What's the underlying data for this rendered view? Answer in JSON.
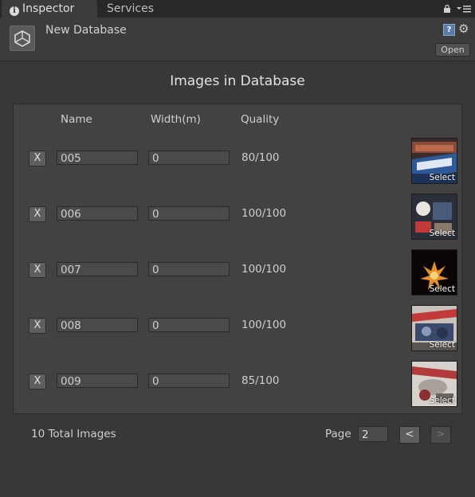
{
  "tabs": {
    "inspector": "Inspector",
    "services": "Services"
  },
  "header": {
    "title": "New Database",
    "open_label": "Open",
    "help_glyph": "?"
  },
  "section_title": "Images in Database",
  "columns": {
    "name": "Name",
    "width": "Width(m)",
    "quality": "Quality"
  },
  "rows": [
    {
      "remove": "X",
      "name": "005",
      "width": "0",
      "quality": "80/100",
      "thumb_label": "Select"
    },
    {
      "remove": "X",
      "name": "006",
      "width": "0",
      "quality": "100/100",
      "thumb_label": "Select"
    },
    {
      "remove": "X",
      "name": "007",
      "width": "0",
      "quality": "100/100",
      "thumb_label": "Select"
    },
    {
      "remove": "X",
      "name": "008",
      "width": "0",
      "quality": "100/100",
      "thumb_label": "Select"
    },
    {
      "remove": "X",
      "name": "009",
      "width": "0",
      "quality": "85/100",
      "thumb_label": "Select"
    }
  ],
  "footer": {
    "total": "10 Total Images",
    "page_label": "Page",
    "page_value": "2",
    "prev": "<",
    "next": ">"
  },
  "icons": [
    "info-icon",
    "lock-icon",
    "menu-icon",
    "unity-icon",
    "help-icon",
    "gear-icon"
  ],
  "colors": {
    "background": "#383838",
    "panel": "#424242",
    "tabbar": "#282828"
  }
}
